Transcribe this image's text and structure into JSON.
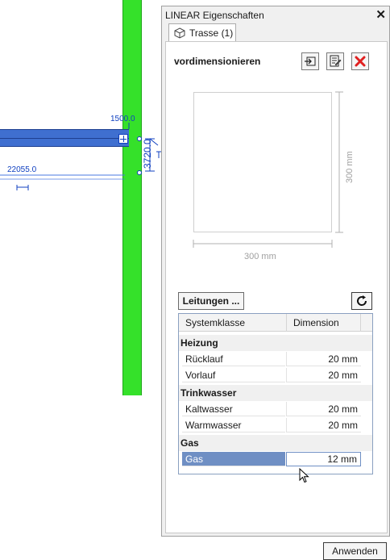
{
  "cad": {
    "dim_top": "1500.0",
    "dim_left": "22055.0",
    "dim_vertical": "3720.0"
  },
  "window": {
    "title": "LINEAR Eigenschaften",
    "close_symbol": "✕"
  },
  "tab": {
    "label": "Trasse (1)",
    "icon": "cube-icon"
  },
  "section": {
    "title": "vordimensionieren"
  },
  "toolbar": {
    "icons": [
      "import-icon",
      "edit-list-icon",
      "delete-icon"
    ],
    "delete_color": "#e02020"
  },
  "preview": {
    "width_label": "300 mm",
    "height_label": "300 mm"
  },
  "buttons": {
    "leitungen": "Leitungen ...",
    "refresh_icon": "refresh-icon",
    "apply": "Anwenden"
  },
  "grid": {
    "columns": [
      "Systemklasse",
      "Dimension"
    ],
    "groups": [
      {
        "name": "Heizung",
        "rows": [
          {
            "name": "Rücklauf",
            "value": "20 mm"
          },
          {
            "name": "Vorlauf",
            "value": "20 mm"
          }
        ]
      },
      {
        "name": "Trinkwasser",
        "rows": [
          {
            "name": "Kaltwasser",
            "value": "20 mm"
          },
          {
            "name": "Warmwasser",
            "value": "20 mm"
          }
        ]
      },
      {
        "name": "Gas",
        "rows": [
          {
            "name": "Gas",
            "value": "12 mm"
          }
        ]
      }
    ]
  },
  "colors": {
    "green_element": "#35e12a",
    "blue_element": "#3f6fd0",
    "selection": "#6f8fc4"
  }
}
